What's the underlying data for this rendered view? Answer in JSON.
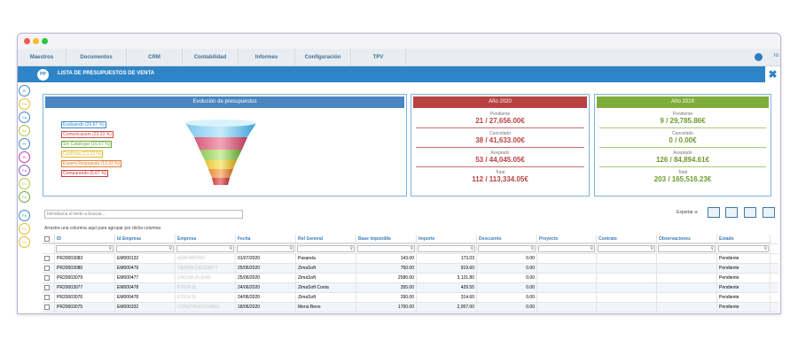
{
  "menu": [
    "Maestros",
    "Documentos",
    "CRM",
    "Contabilidad",
    "Informes",
    "Configuración",
    "TPV"
  ],
  "user_name": "ro",
  "header": {
    "badge": "PP",
    "title": "LISTA DE PRESUPUESTOS DE VENTA",
    "close": "✖"
  },
  "left_rail": [
    "Pr",
    "Pe",
    "Ca",
    "Ac",
    "Pr",
    "Pr",
    "Fa",
    "Ev",
    "Co",
    "Fa",
    "Ex",
    "Co"
  ],
  "funnel_panel": {
    "title": "Evolución de presupuestos",
    "legend": [
      {
        "label": "Evaluando (26.67 %)",
        "color": "#3b88c6"
      },
      {
        "label": "Comunicacion (23.33 %)",
        "color": "#d04b4b"
      },
      {
        "label": "Sin Catalogar (16.67 %)",
        "color": "#6aa83a"
      },
      {
        "label": "Confirma (13.33 %)",
        "color": "#e5b82a"
      },
      {
        "label": "Espera Respuesta (13.33 %)",
        "color": "#e07b2f"
      },
      {
        "label": "Comparando (6.67 %)",
        "color": "#c43b3b"
      }
    ]
  },
  "year_2020": {
    "title": "Año 2020",
    "color": "#b84242",
    "stats": [
      {
        "label": "Pendiente",
        "count": "21",
        "amount": "27,656.00€"
      },
      {
        "label": "Cancelado",
        "count": "38",
        "amount": "41,633.00€"
      },
      {
        "label": "Aceptado",
        "count": "53",
        "amount": "44,045.05€"
      },
      {
        "label": "Total",
        "count": "112",
        "amount": "113,334.05€"
      }
    ]
  },
  "year_2019": {
    "title": "Año 2019",
    "color": "#7fad3c",
    "stats": [
      {
        "label": "Pendiente",
        "count": "9",
        "amount": "29,785.86€"
      },
      {
        "label": "Cancelado",
        "count": "0",
        "amount": "0.00€"
      },
      {
        "label": "Aceptado",
        "count": "126",
        "amount": "84,894.61€"
      },
      {
        "label": "Total",
        "count": "203",
        "amount": "165,516.23€"
      }
    ]
  },
  "search": {
    "placeholder": "Introduzca el texto a buscar..."
  },
  "export_label": "Exportar a:",
  "group_hint": "Arrastre una columna aquí para agrupar por dicha columna",
  "columns": [
    "ID",
    "Id Empresa",
    "Empresa",
    "Fecha",
    "Ref General",
    "Base imponible",
    "Importe",
    "Descuento",
    "Proyecto",
    "Contrato",
    "Observaciones",
    "Estado"
  ],
  "rows": [
    [
      "PR20003083",
      "EM000132",
      "ADM MATRIX",
      "01/07/2020",
      "Pasarela",
      "143.00",
      "173.03",
      "0.00",
      "",
      "",
      "",
      "Pendiente"
    ],
    [
      "PR20003080",
      "EM000479",
      "TIENDA CALIDAD Y",
      "25/06/2020",
      "ZimaSoft",
      "760.00",
      "919.60",
      "0.00",
      "",
      "",
      "",
      "Pendiente"
    ],
    [
      "PR20003079",
      "EM000477",
      "ESCUELA LEAN",
      "25/06/2020",
      "ZimaSoft",
      "2580.00",
      "3,121.80",
      "0.00",
      "",
      "",
      "",
      "Pendiente"
    ],
    [
      "PR20003077",
      "EM000478",
      "ETICA SL",
      "24/06/2020",
      "ZimaSoft Conta",
      "355.00",
      "429.55",
      "0.00",
      "",
      "",
      "",
      "Pendiente"
    ],
    [
      "PR20003076",
      "EM000478",
      "ETICA SL",
      "24/06/2020",
      "ZimaSoft",
      "260.00",
      "314.60",
      "0.00",
      "",
      "",
      "",
      "Pendiente"
    ],
    [
      "PR20003075",
      "EM000332",
      "CONSTRUCCIONES",
      "18/06/2020",
      "Menú Beno",
      "1700.00",
      "2,057.00",
      "0.00",
      "",
      "",
      "",
      "Pendiente"
    ]
  ]
}
